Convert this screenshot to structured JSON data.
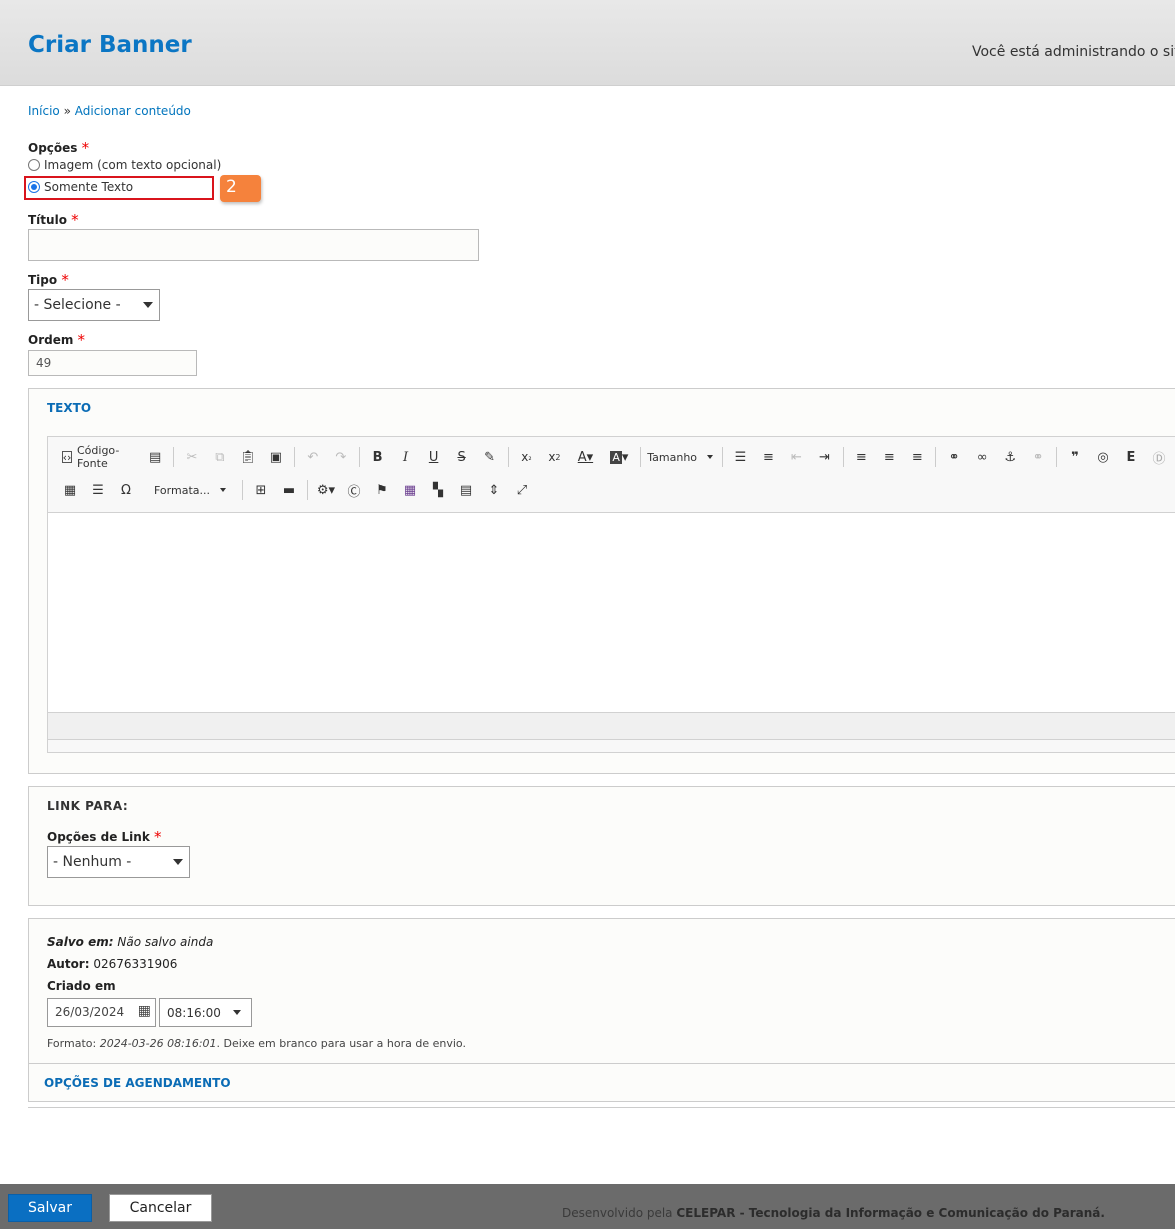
{
  "header": {
    "title": "Criar Banner",
    "site_text": "Você está administrando o site"
  },
  "breadcrumb": {
    "home": "Início",
    "separator": " » ",
    "current": "Adicionar conteúdo"
  },
  "options": {
    "label": "Opções",
    "required_mark": "*",
    "radio_image": "Imagem (com texto opcional)",
    "radio_text_only": "Somente Texto",
    "selected": "Somente Texto",
    "step_badge": "2"
  },
  "title_field": {
    "label": "Título",
    "value": ""
  },
  "type_field": {
    "label": "Tipo",
    "selected": "- Selecione -"
  },
  "order_field": {
    "label": "Ordem",
    "value": "49"
  },
  "texto": {
    "legend": "TEXTO",
    "source_button": "Código-Fonte",
    "size_dropdown": "Tamanho",
    "format_dropdown": "Formata...",
    "toolbar_icons": [
      "source-icon",
      "templates-icon",
      "cut-icon",
      "copy-icon",
      "paste-icon",
      "paste-text-icon",
      "undo-icon",
      "redo-icon",
      "bold-icon",
      "italic-icon",
      "underline-icon",
      "strike-icon",
      "remove-format-icon",
      "subscript-icon",
      "superscript-icon",
      "text-color-icon",
      "bg-color-icon",
      "bullet-list-icon",
      "numbered-list-icon",
      "outdent-icon",
      "indent-icon",
      "align-left-icon",
      "align-center-icon",
      "align-right-icon",
      "link-icon",
      "unlink-icon",
      "anchor-icon",
      "remove-link-icon",
      "blockquote-icon",
      "globe-icon",
      "table-icon",
      "hr-icon",
      "omega-icon",
      "maximize-icon"
    ]
  },
  "link_section": {
    "legend": "LINK PARA:",
    "label": "Opções de Link",
    "selected": "- Nenhum -"
  },
  "meta": {
    "saved_label": "Salvo em:",
    "saved_value": "Não salvo ainda",
    "author_label": "Autor:",
    "author_value": "02676331906",
    "created_label": "Criado em",
    "date_value": "26/03/2024",
    "time_value": "08:16:00",
    "format_prefix": "Formato: ",
    "format_example": "2024-03-26 08:16:01",
    "format_suffix": ". Deixe em branco para usar a hora de envio.",
    "schedule_link": "OPÇÕES DE AGENDAMENTO"
  },
  "footer": {
    "save_label": "Salvar",
    "cancel_label": "Cancelar",
    "dev_prefix": "Desenvolvido pela ",
    "dev_company": "CELEPAR - Tecnologia da Informação e Comunicação do Paraná."
  },
  "colors": {
    "accent": "#0b76c4",
    "footer_bg": "#6b6b6b",
    "badge": "#f5823c",
    "highlight": "#d9141c"
  }
}
